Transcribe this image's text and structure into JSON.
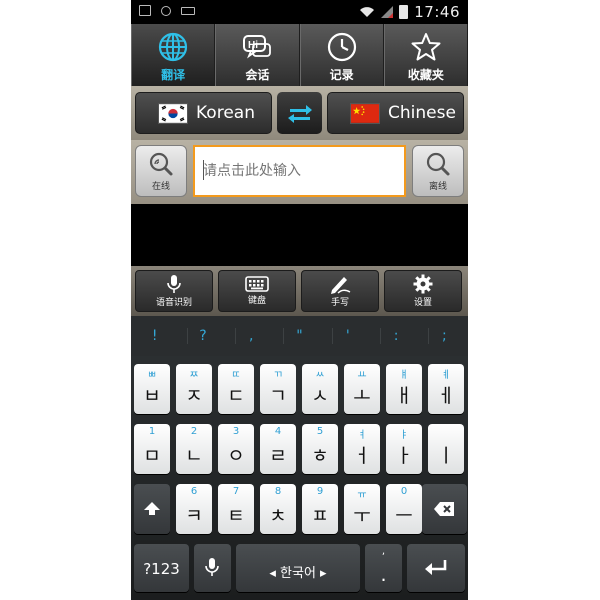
{
  "status": {
    "time": "17:46"
  },
  "tabs": [
    {
      "label": "翻译",
      "icon": "globe-icon",
      "active": true
    },
    {
      "label": "会话",
      "icon": "hi-chat-icon",
      "active": false
    },
    {
      "label": "记录",
      "icon": "clock-icon",
      "active": false
    },
    {
      "label": "收藏夹",
      "icon": "star-icon",
      "active": false
    }
  ],
  "languages": {
    "source": "Korean",
    "target": "Chinese",
    "swap_icon": "swap-arrows-icon"
  },
  "search": {
    "online_label": "在线",
    "offline_label": "离线",
    "placeholder": "请点击此处输入",
    "value": ""
  },
  "tools": [
    {
      "label": "语音识别",
      "icon": "microphone-icon"
    },
    {
      "label": "键盘",
      "icon": "keyboard-icon"
    },
    {
      "label": "手写",
      "icon": "pen-icon"
    },
    {
      "label": "设置",
      "icon": "gear-icon"
    }
  ],
  "keyboard": {
    "symbols": [
      "!",
      "?",
      ",",
      "\"",
      "'",
      ":",
      ";"
    ],
    "row1": [
      {
        "main": "ㅂ",
        "hint": "ㅃ"
      },
      {
        "main": "ㅈ",
        "hint": "ㅉ"
      },
      {
        "main": "ㄷ",
        "hint": "ㄸ"
      },
      {
        "main": "ㄱ",
        "hint": "ㄲ"
      },
      {
        "main": "ㅅ",
        "hint": "ㅆ"
      },
      {
        "main": "ㅗ",
        "hint": "ㅛ"
      },
      {
        "main": "ㅐ",
        "hint": "ㅒ"
      },
      {
        "main": "ㅔ",
        "hint": "ㅖ"
      }
    ],
    "row2": [
      {
        "main": "ㅁ",
        "hint": "1"
      },
      {
        "main": "ㄴ",
        "hint": "2"
      },
      {
        "main": "ㅇ",
        "hint": "3"
      },
      {
        "main": "ㄹ",
        "hint": "4"
      },
      {
        "main": "ㅎ",
        "hint": "5"
      },
      {
        "main": "ㅓ",
        "hint": "ㅕ"
      },
      {
        "main": "ㅏ",
        "hint": "ㅑ"
      },
      {
        "main": "ㅣ",
        "hint": ""
      }
    ],
    "row3": [
      {
        "main": "ㅋ",
        "hint": "6"
      },
      {
        "main": "ㅌ",
        "hint": "7"
      },
      {
        "main": "ㅊ",
        "hint": "8"
      },
      {
        "main": "ㅍ",
        "hint": "9"
      },
      {
        "main": "ㅜ",
        "hint": "ㅠ"
      },
      {
        "main": "ㅡ",
        "hint": "0"
      }
    ],
    "symbols_key": "?123",
    "space_label": "◂ 한국어 ▸",
    "period_main": ".",
    "period_hint": ","
  },
  "colors": {
    "accent": "#2fc0e8",
    "input_border": "#f39a1d",
    "hint": "#2f9fd3"
  }
}
